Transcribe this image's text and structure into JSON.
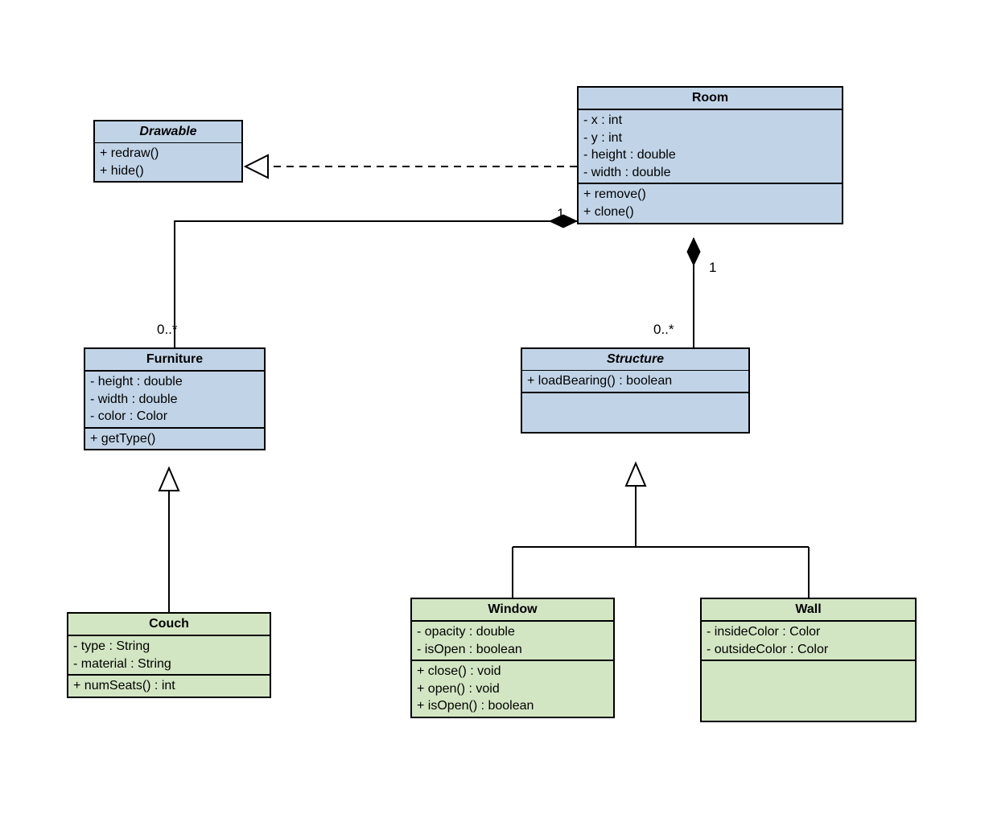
{
  "diagram": {
    "drawable": {
      "name": "Drawable",
      "methods": [
        "+ redraw()",
        "+ hide()"
      ]
    },
    "room": {
      "name": "Room",
      "attrs": [
        "- x : int",
        "- y : int",
        "- height : double",
        "- width : double"
      ],
      "methods": [
        "+ remove()",
        "+ clone()"
      ]
    },
    "furniture": {
      "name": "Furniture",
      "attrs": [
        "- height : double",
        "- width : double",
        "- color : Color"
      ],
      "methods": [
        "+ getType()"
      ]
    },
    "structure": {
      "name": "Structure",
      "methods": [
        "+ loadBearing() : boolean"
      ]
    },
    "couch": {
      "name": "Couch",
      "attrs": [
        "- type : String",
        "- material : String"
      ],
      "methods": [
        "+ numSeats() : int"
      ]
    },
    "window": {
      "name": "Window",
      "attrs": [
        "- opacity : double",
        "- isOpen : boolean"
      ],
      "methods": [
        "+ close() : void",
        "+ open() : void",
        "+ isOpen() : boolean"
      ]
    },
    "wall": {
      "name": "Wall",
      "attrs": [
        "- insideColor : Color",
        "- outsideColor : Color"
      ]
    },
    "mult": {
      "room_furniture_room": "1",
      "room_furniture_furn": "0..*",
      "room_structure_room": "1",
      "room_structure_struct": "0..*"
    }
  }
}
